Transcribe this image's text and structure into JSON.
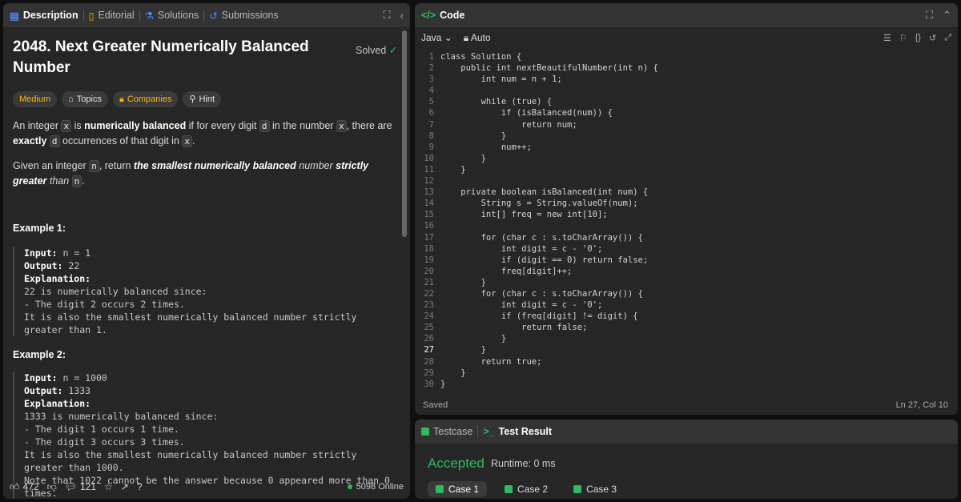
{
  "left": {
    "tabs": [
      "Description",
      "Editorial",
      "Solutions",
      "Submissions"
    ],
    "title": "2048. Next Greater Numerically Balanced Number",
    "solved": "Solved",
    "chips": [
      "Medium",
      "Topics",
      "Companies",
      "Hint"
    ],
    "p1": {
      "a": "An integer ",
      "x": "x",
      "b": " is ",
      "strong": "numerically balanced",
      "c": " if for every digit ",
      "d": "d",
      "e": " in the number ",
      "x2": "x",
      "f": ", there are ",
      "exactly": "exactly",
      "g": " ",
      "d2": "d",
      "h": " occurrences of that digit in ",
      "x3": "x",
      "i": "."
    },
    "p2": {
      "a": "Given an integer ",
      "n": "n",
      "b": ", return ",
      "em1": "the smallest numerically balanced",
      "c": " number ",
      "em2": "strictly greater",
      "d": " than ",
      "n2": "n",
      "e": "."
    },
    "ex1": {
      "title": "Example 1:",
      "input": "Input: ",
      "inputv": "n = 1",
      "output": "Output: ",
      "outputv": "22",
      "expl": "Explanation:",
      "body": "22 is numerically balanced since:\n- The digit 2 occurs 2 times.\nIt is also the smallest numerically balanced number strictly greater than 1."
    },
    "ex2": {
      "title": "Example 2:",
      "input": "Input: ",
      "inputv": "n = 1000",
      "output": "Output: ",
      "outputv": "1333",
      "expl": "Explanation:",
      "body": "1333 is numerically balanced since:\n- The digit 1 occurs 1 time.\n- The digit 3 occurs 3 times.\nIt is also the smallest numerically balanced number strictly greater than 1000.\nNote that 1022 cannot be the answer because 0 appeared more than 0 times."
    },
    "footer": {
      "likes": "472",
      "comments": "121",
      "online": "5098 Online"
    }
  },
  "code": {
    "title": "Code",
    "lang": "Java",
    "mode": "Auto",
    "status": "Saved",
    "position": "Ln 27, Col 10",
    "lines": [
      "class Solution {",
      "    public int nextBeautifulNumber(int n) {",
      "        int num = n + 1;",
      "",
      "        while (true) {",
      "            if (isBalanced(num)) {",
      "                return num;",
      "            }",
      "            num++;",
      "        }",
      "    }",
      "",
      "    private boolean isBalanced(int num) {",
      "        String s = String.valueOf(num);",
      "        int[] freq = new int[10];",
      "",
      "        for (char c : s.toCharArray()) {",
      "            int digit = c - '0';",
      "            if (digit == 0) return false;",
      "            freq[digit]++;",
      "        }",
      "        for (char c : s.toCharArray()) {",
      "            int digit = c - '0';",
      "            if (freq[digit] != digit) {",
      "                return false;",
      "            }",
      "        }",
      "        return true;",
      "    }",
      "}"
    ],
    "current_line": 27
  },
  "result": {
    "tabs": [
      "Testcase",
      "Test Result"
    ],
    "verdict": "Accepted",
    "runtime": "Runtime: 0 ms",
    "cases": [
      "Case 1",
      "Case 2",
      "Case 3"
    ]
  }
}
